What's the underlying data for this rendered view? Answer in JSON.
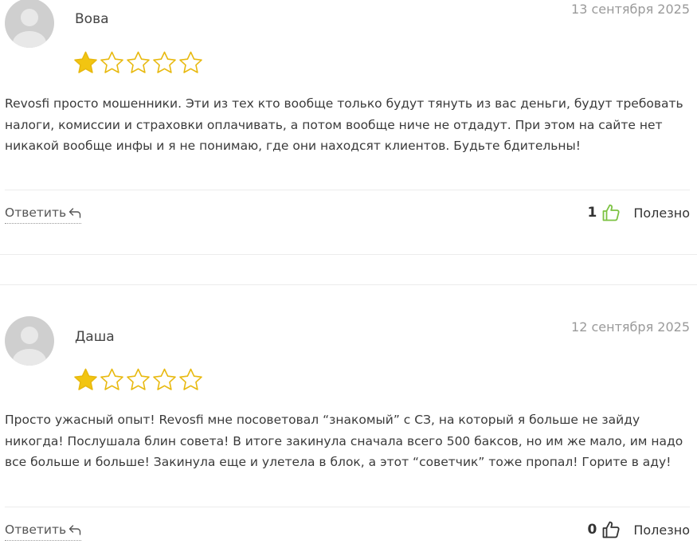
{
  "reviews": [
    {
      "author": "Вова",
      "date": "13 сентября 2025",
      "rating": 1,
      "max_rating": 5,
      "text": "Revosfi просто мошенники. Эти из тех кто вообще только будут тянуть из вас деньги, будут требовать налоги, комиссии и страховки оплачивать, а потом вообще ниче не отдадут. При этом на сайте нет никакой вообще инфы и я не понимаю, где они находсят клиентов. Будьте бдительны!",
      "reply_label": "Ответить",
      "helpful_count": "1",
      "helpful_label": "Полезно",
      "thumb_color": "#7cc242"
    },
    {
      "author": "Даша",
      "date": "12 сентября 2025",
      "rating": 1,
      "max_rating": 5,
      "text": "Просто ужасный опыт! Revosfi мне посоветовал “знакомый” с СЗ, на который я больше не зайду никогда! Послушала блин совета! В итоге закинула сначала всего 500 баксов, но им же мало, им надо все больше и больше! Закинула еще и улетела в блок, а этот “советчик” тоже пропал! Горите в аду!",
      "reply_label": "Ответить",
      "helpful_count": "0",
      "helpful_label": "Полезно",
      "thumb_color": "#333333"
    }
  ],
  "colors": {
    "star_fill": "#f2c511",
    "star_outline": "#e8b90f"
  },
  "icons": {
    "avatar": "user-placeholder-icon",
    "star": "star-icon",
    "reply": "reply-arrow-icon",
    "helpful": "thumbs-up-icon"
  }
}
